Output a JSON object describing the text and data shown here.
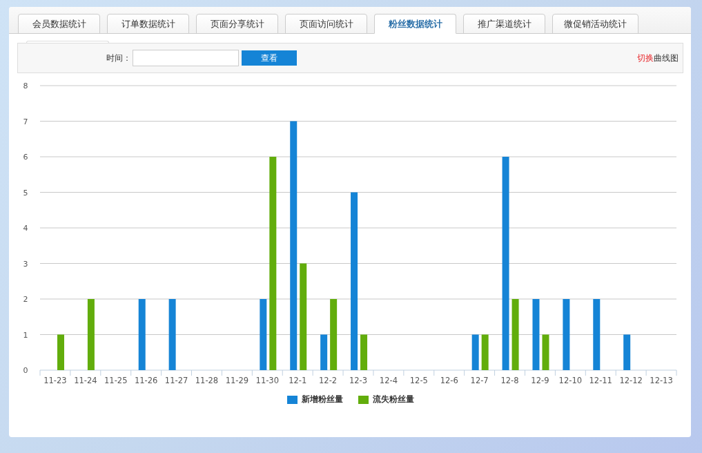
{
  "tabs": [
    {
      "label": "会员数据统计",
      "selected": false
    },
    {
      "label": "订单数据统计",
      "selected": false
    },
    {
      "label": "页面分享统计",
      "selected": false
    },
    {
      "label": "页面访问统计",
      "selected": false
    },
    {
      "label": "粉丝数据统计",
      "selected": true
    },
    {
      "label": "推广渠道统计",
      "selected": false
    },
    {
      "label": "微促销活动统计",
      "selected": false
    }
  ],
  "filter": {
    "label": "时间：",
    "button": "查看"
  },
  "toggle": {
    "action": "切换",
    "target": "曲线图"
  },
  "chart_data": {
    "type": "bar",
    "categories": [
      "11-23",
      "11-24",
      "11-25",
      "11-26",
      "11-27",
      "11-28",
      "11-29",
      "11-30",
      "12-1",
      "12-2",
      "12-3",
      "12-4",
      "12-5",
      "12-6",
      "12-7",
      "12-8",
      "12-9",
      "12-10",
      "12-11",
      "12-12",
      "12-13"
    ],
    "series": [
      {
        "name": "新增粉丝量",
        "color": "#1584d6",
        "values": [
          0,
          0,
          0,
          2,
          2,
          0,
          0,
          2,
          7,
          1,
          5,
          0,
          0,
          0,
          1,
          6,
          2,
          2,
          2,
          1,
          0
        ]
      },
      {
        "name": "流失粉丝量",
        "color": "#62ad0c",
        "values": [
          1,
          2,
          0,
          0,
          0,
          0,
          0,
          6,
          3,
          2,
          1,
          0,
          0,
          0,
          1,
          2,
          1,
          0,
          0,
          0,
          0
        ]
      }
    ],
    "ylim": [
      0,
      8
    ],
    "yticks": [
      0,
      1,
      2,
      3,
      4,
      5,
      6,
      7,
      8
    ],
    "grid": true,
    "legend": true
  }
}
